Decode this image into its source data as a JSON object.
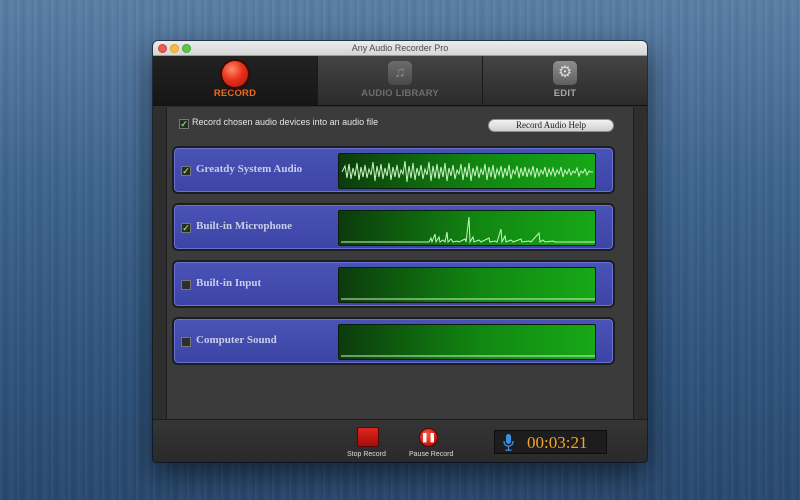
{
  "window": {
    "title": "Any Audio Recorder Pro"
  },
  "tabs": [
    {
      "label": "RECORD",
      "icon": "record-icon",
      "active": true
    },
    {
      "label": "AUDIO LIBRARY",
      "icon": "music-note-icon",
      "active": false
    },
    {
      "label": "EDIT",
      "icon": "gear-icon",
      "active": false
    }
  ],
  "record_option": {
    "label": "Record chosen audio devices into an audio file",
    "checked": true
  },
  "help_button": {
    "label": "Record Audio Help"
  },
  "devices": [
    {
      "name": "Greatdy System Audio",
      "checked": true
    },
    {
      "name": "Built-in Microphone",
      "checked": true
    },
    {
      "name": "Built-in Input",
      "checked": false
    },
    {
      "name": "Computer Sound",
      "checked": false
    }
  ],
  "controls": {
    "stop_label": "Stop Record",
    "pause_label": "Pause Record",
    "timer": "00:03:21"
  },
  "colors": {
    "accent": "#f06a1c",
    "timer": "#f5a623",
    "device_panel": "#4a53b6",
    "meter_green": "#17a817"
  }
}
